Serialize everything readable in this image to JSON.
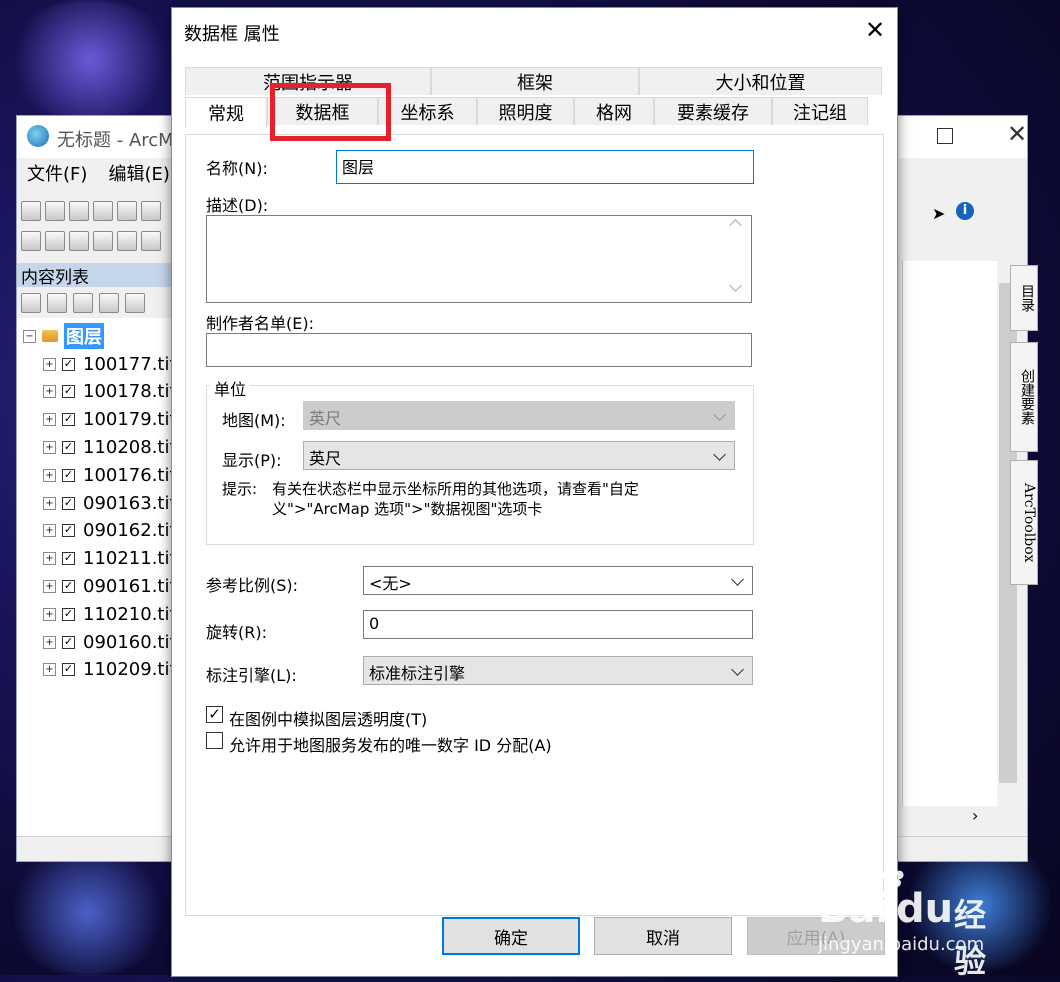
{
  "arcmap": {
    "title": "无标题 - ArcM",
    "menu": [
      "文件(F)",
      "编辑(E)"
    ],
    "toc_title": "内容列表",
    "root_layer": "图层",
    "layers": [
      "100177.tif",
      "100178.tif",
      "100179.tif",
      "110208.tif",
      "100176.tif",
      "090163.tif",
      "090162.tif",
      "110211.tif",
      "090161.tif",
      "110210.tif",
      "090160.tif",
      "110209.tif"
    ],
    "side_tabs": [
      "目录",
      "创建要素",
      "ArcToolbox"
    ]
  },
  "dialog": {
    "title": "数据框 属性",
    "tabs_row1": [
      "范围指示器",
      "框架",
      "大小和位置"
    ],
    "tabs_row2": [
      "常规",
      "数据框",
      "坐标系",
      "照明度",
      "格网",
      "要素缓存",
      "注记组"
    ],
    "general": {
      "name_label": "名称(N):",
      "name_value": "图层",
      "desc_label": "描述(D):",
      "desc_value": "",
      "credits_label": "制作者名单(E):",
      "credits_value": "",
      "units_group": "单位",
      "map_units_label": "地图(M):",
      "map_units_value": "英尺",
      "display_units_label": "显示(P):",
      "display_units_value": "英尺",
      "hint_label": "提示:",
      "hint_text_1": "有关在状态栏中显示坐标所用的其他选项，请查看\"自定",
      "hint_text_2": "义\">\"ArcMap 选项\">\"数据视图\"选项卡",
      "ref_scale_label": "参考比例(S):",
      "ref_scale_value": "<无>",
      "rotation_label": "旋转(R):",
      "rotation_value": "0",
      "label_engine_label": "标注引擎(L):",
      "label_engine_value": "标准标注引擎",
      "check_transparency_label": "在图例中模拟图层透明度(T)",
      "check_transparency_checked": true,
      "check_unique_id_label": "允许用于地图服务发布的唯一数字 ID 分配(A)",
      "check_unique_id_checked": false
    },
    "buttons": {
      "ok": "确定",
      "cancel": "取消",
      "apply": "应用(A)"
    }
  },
  "watermark": {
    "brand": "Bai",
    "brand2": "du",
    "jingyan": "经验",
    "url": "jingyan.baidu.com"
  },
  "colors": {
    "highlight_box": "#e8202a",
    "focus_border": "#0078d7",
    "toc_header": "#c6d6ea"
  }
}
